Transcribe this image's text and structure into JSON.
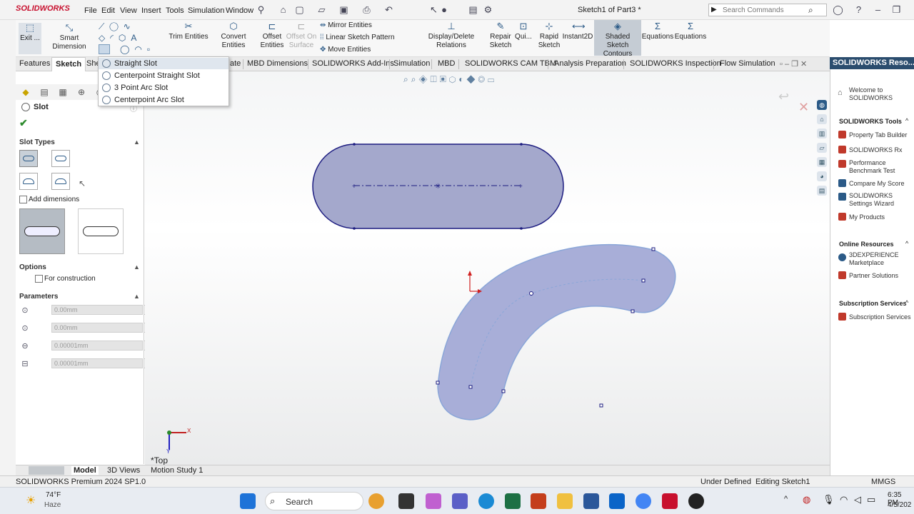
{
  "app": {
    "logo": "SOLIDWORKS",
    "doc_title": "Sketch1 of Part3 *"
  },
  "menu": [
    "File",
    "Edit",
    "View",
    "Insert",
    "Tools",
    "Simulation",
    "Window"
  ],
  "search": {
    "placeholder": "Search Commands"
  },
  "ribbon": {
    "exit": "Exit ...",
    "smart_dimension": "Smart Dimension",
    "trim": "Trim Entities",
    "convert": "Convert Entities",
    "offset_1": "Offset",
    "offset_2": "Entities",
    "offset_surface_1": "Offset On",
    "offset_surface_2": "Surface",
    "mirror": "Mirror Entities",
    "linear_pattern": "Linear Sketch Pattern",
    "move": "Move Entities",
    "display_delete": "Display/Delete Relations",
    "repair_1": "Repair",
    "repair_2": "Sketch",
    "quick": "Qui...",
    "rapid_1": "Rapid",
    "rapid_2": "Sketch",
    "instant2d": "Instant2D",
    "shaded_1": "Shaded Sketch",
    "shaded_2": "Contours",
    "equations_1": "Equations",
    "equations_2": "Equations"
  },
  "tabs": [
    "Features",
    "Sketch",
    "She",
    "ate",
    "MBD Dimensions",
    "SOLIDWORKS Add-Ins",
    "Simulation",
    "MBD",
    "SOLIDWORKS CAM TBM",
    "Analysis Preparation",
    "SOLIDWORKS Inspection",
    "Flow Simulation"
  ],
  "dropdown": [
    "Straight Slot",
    "Centerpoint Straight Slot",
    "3 Point Arc Slot",
    "Centerpoint Arc Slot"
  ],
  "pm": {
    "title": "Slot",
    "slot_types": "Slot Types",
    "add_dimensions": "Add dimensions",
    "options": "Options",
    "for_construction": "For construction",
    "parameters": "Parameters",
    "params": [
      "0.00mm",
      "0.00mm",
      "0.00001mm",
      "0.00001mm"
    ]
  },
  "viewport": {
    "view_label": "*Top",
    "axis_x": "X",
    "axis_y": "Y"
  },
  "taskpane": {
    "header": "SOLIDWORKS Reso...",
    "welcome": "Welcome to SOLIDWORKS",
    "tools_title": "SOLIDWORKS Tools",
    "tools": [
      "Property Tab Builder",
      "SOLIDWORKS Rx",
      "Performance Benchmark Test",
      "Compare My Score",
      "SOLIDWORKS Settings Wizard",
      "My Products"
    ],
    "online_title": "Online Resources",
    "online": [
      "3DEXPERIENCE Marketplace",
      "Partner Solutions"
    ],
    "sub_title": "Subscription Services",
    "sub": [
      "Subscription Services"
    ]
  },
  "bottom_tabs": [
    "Model",
    "3D Views",
    "Motion Study 1"
  ],
  "status": {
    "product": "SOLIDWORKS Premium 2024 SP1.0",
    "defined": "Under Defined",
    "editing": "Editing Sketch1",
    "units": "MMGS"
  },
  "taskbar": {
    "temp": "74°F",
    "weather": "Haze",
    "search": "Search",
    "time": "6:35 PM",
    "date": "4/5/202"
  }
}
